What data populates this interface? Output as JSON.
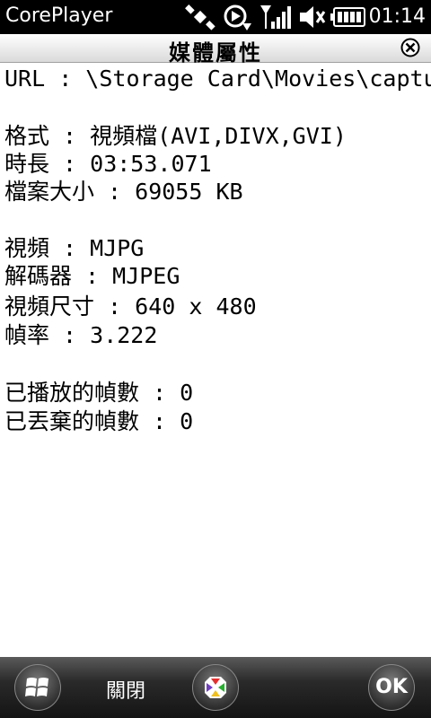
{
  "status_bar": {
    "app_title": "CorePlayer",
    "time": "01:14",
    "icons": [
      "satellite-icon",
      "sync-icon",
      "signal-icon",
      "volume-icon",
      "battery-icon"
    ]
  },
  "dialog": {
    "title": "媒體屬性",
    "close_icon": "close-icon"
  },
  "properties": {
    "url": "URL : \\Storage Card\\Movies\\capture",
    "format": "格式 : 視頻檔(AVI,DIVX,GVI)",
    "duration": "時長 : 03:53.071",
    "file_size": "檔案大小 : 69055 KB",
    "video": "視頻 : MJPG",
    "decoder": "解碼器 : MJPEG",
    "video_size": "視頻尺寸 : 640 x 480",
    "frame_rate": "幀率 : 3.222",
    "frames_played": "已播放的幀數 : 0",
    "frames_dropped": "已丟棄的幀數 : 0"
  },
  "bottom_bar": {
    "close_label": "關閉",
    "ok_label": "OK",
    "start_icon": "windows-start-icon",
    "center_icon": "coreplayer-icon"
  }
}
